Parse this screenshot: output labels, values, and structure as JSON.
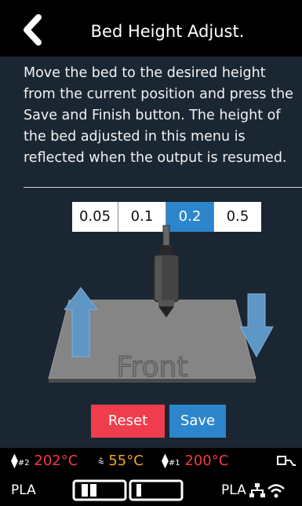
{
  "header": {
    "title": "Bed Height Adjust.",
    "back_icon": "chevron-left-icon"
  },
  "description": "Move the bed to the desired height from the current position and press the Save and Finish button. The height of the bed adjusted in this menu is reflected when the output is resumed.",
  "step_sizes": {
    "options": [
      "0.05",
      "0.1",
      "0.2",
      "0.5"
    ],
    "selected": "0.2"
  },
  "illustration": {
    "plate_label": "Front",
    "up_arrow_icon": "arrow-up-icon",
    "down_arrow_icon": "arrow-down-icon"
  },
  "buttons": {
    "reset_label": "Reset",
    "save_label": "Save"
  },
  "status_bar": {
    "extruder2": {
      "label": "#2",
      "temp": "202°C"
    },
    "bed": {
      "temp": "55°C"
    },
    "extruder1": {
      "label": "#1",
      "temp": "200°C"
    },
    "material_left": "PLA",
    "material_right": "PLA",
    "icons": [
      "nozzle-icon",
      "bed-heat-icon",
      "usb-icon",
      "ethernet-icon",
      "wifi-icon"
    ]
  },
  "colors": {
    "accent_blue": "#2d86cc",
    "reset_red": "#ef3d4d",
    "temp_red": "#f23a44",
    "temp_orange": "#f4a623",
    "background": "#1b2633"
  }
}
